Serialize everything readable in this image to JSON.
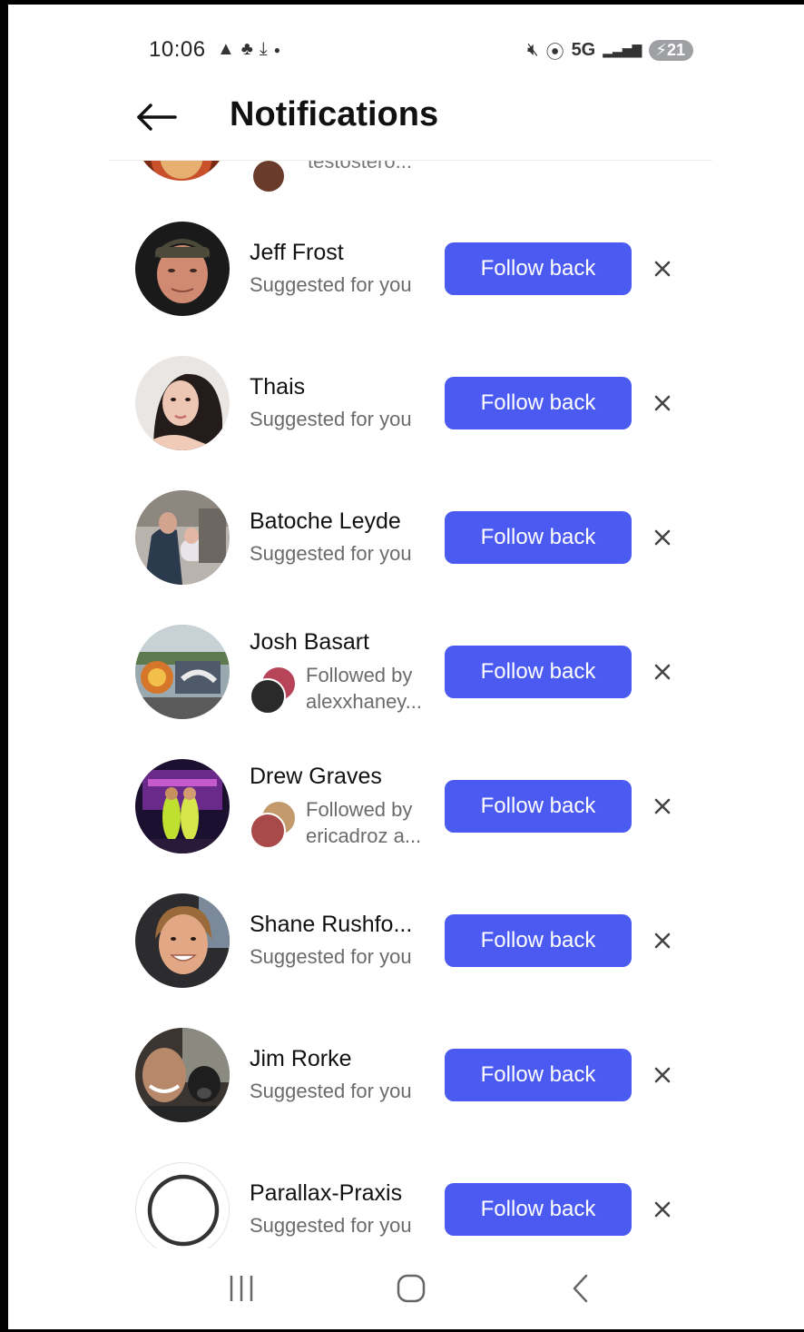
{
  "status_bar": {
    "time": "10:06",
    "left_icons": [
      "warning-icon",
      "snapchat-icon",
      "download-icon",
      "dot-icon"
    ],
    "network": "5G",
    "battery": "21"
  },
  "header": {
    "title": "Notifications"
  },
  "partial_row": {
    "text": "testostero..."
  },
  "rows": [
    {
      "name": "Jeff Frost",
      "subtitle": "Suggested for you",
      "button": "Follow back"
    },
    {
      "name": "Thais",
      "subtitle": "Suggested for you",
      "button": "Follow back"
    },
    {
      "name": "Batoche Leyde",
      "subtitle": "Suggested for you",
      "button": "Follow back"
    },
    {
      "name": "Josh Basart",
      "followed_line1": "Followed by",
      "followed_line2": "alexxhaney...",
      "button": "Follow back"
    },
    {
      "name": "Drew Graves",
      "followed_line1": "Followed by",
      "followed_line2": "ericadroz a...",
      "button": "Follow back"
    },
    {
      "name": "Shane Rushfo...",
      "subtitle": "Suggested for you",
      "button": "Follow back"
    },
    {
      "name": "Jim Rorke",
      "subtitle": "Suggested for you",
      "button": "Follow back"
    },
    {
      "name": "Parallax-Praxis",
      "subtitle": "Suggested for you",
      "button": "Follow back"
    }
  ],
  "colors": {
    "accent": "#4b5bf2",
    "text": "#111111",
    "muted": "#6b6b6b"
  }
}
